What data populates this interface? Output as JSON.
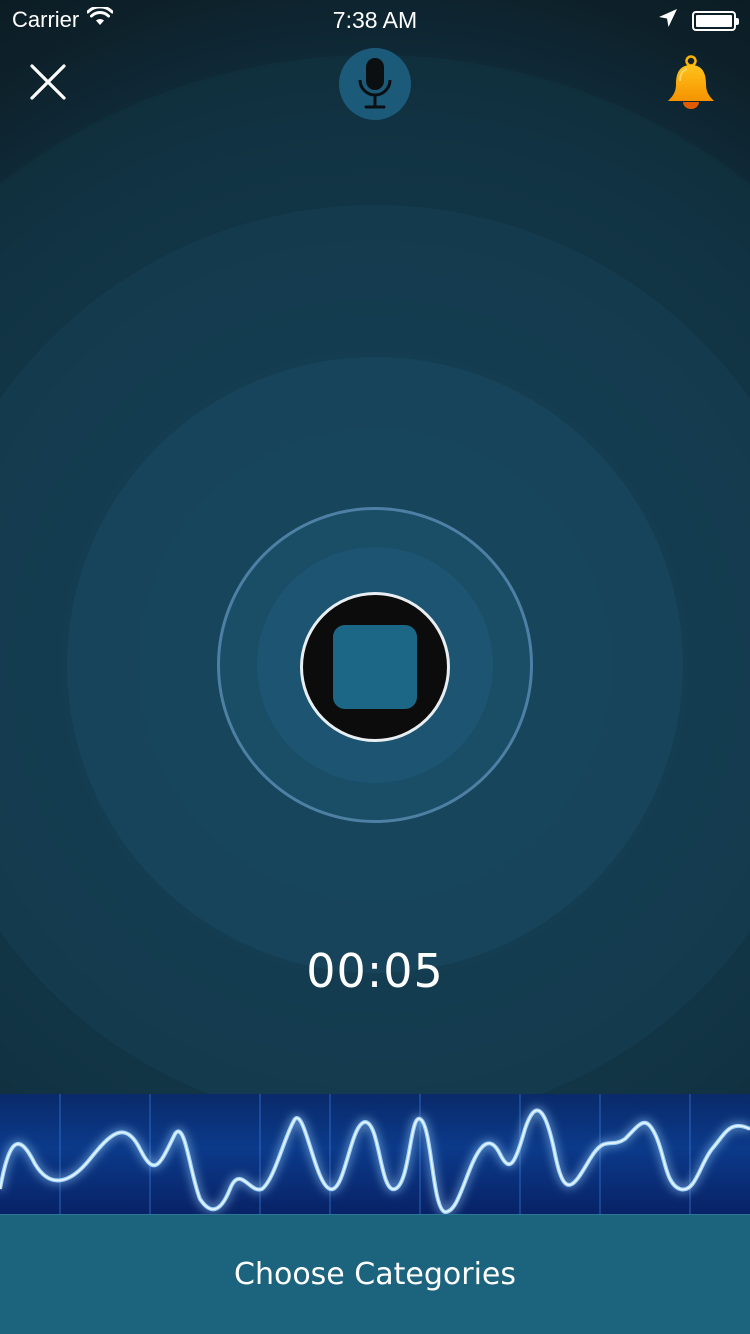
{
  "status_bar": {
    "carrier": "Carrier",
    "time": "7:38 AM",
    "wifi_icon": "wifi-icon",
    "location_icon": "location-arrow-icon",
    "battery_icon": "battery-full-icon"
  },
  "nav": {
    "close_icon": "close-icon",
    "mic_icon": "microphone-icon",
    "bell_icon": "bell-icon",
    "bell_color": "#f7a600",
    "mic_badge_color": "#1c5a7a"
  },
  "recorder": {
    "stop_icon": "stop-icon",
    "elapsed": "00:05",
    "accent": "#1c6686"
  },
  "footer": {
    "choose_label": "Choose Categories",
    "background": "#1c637e"
  }
}
